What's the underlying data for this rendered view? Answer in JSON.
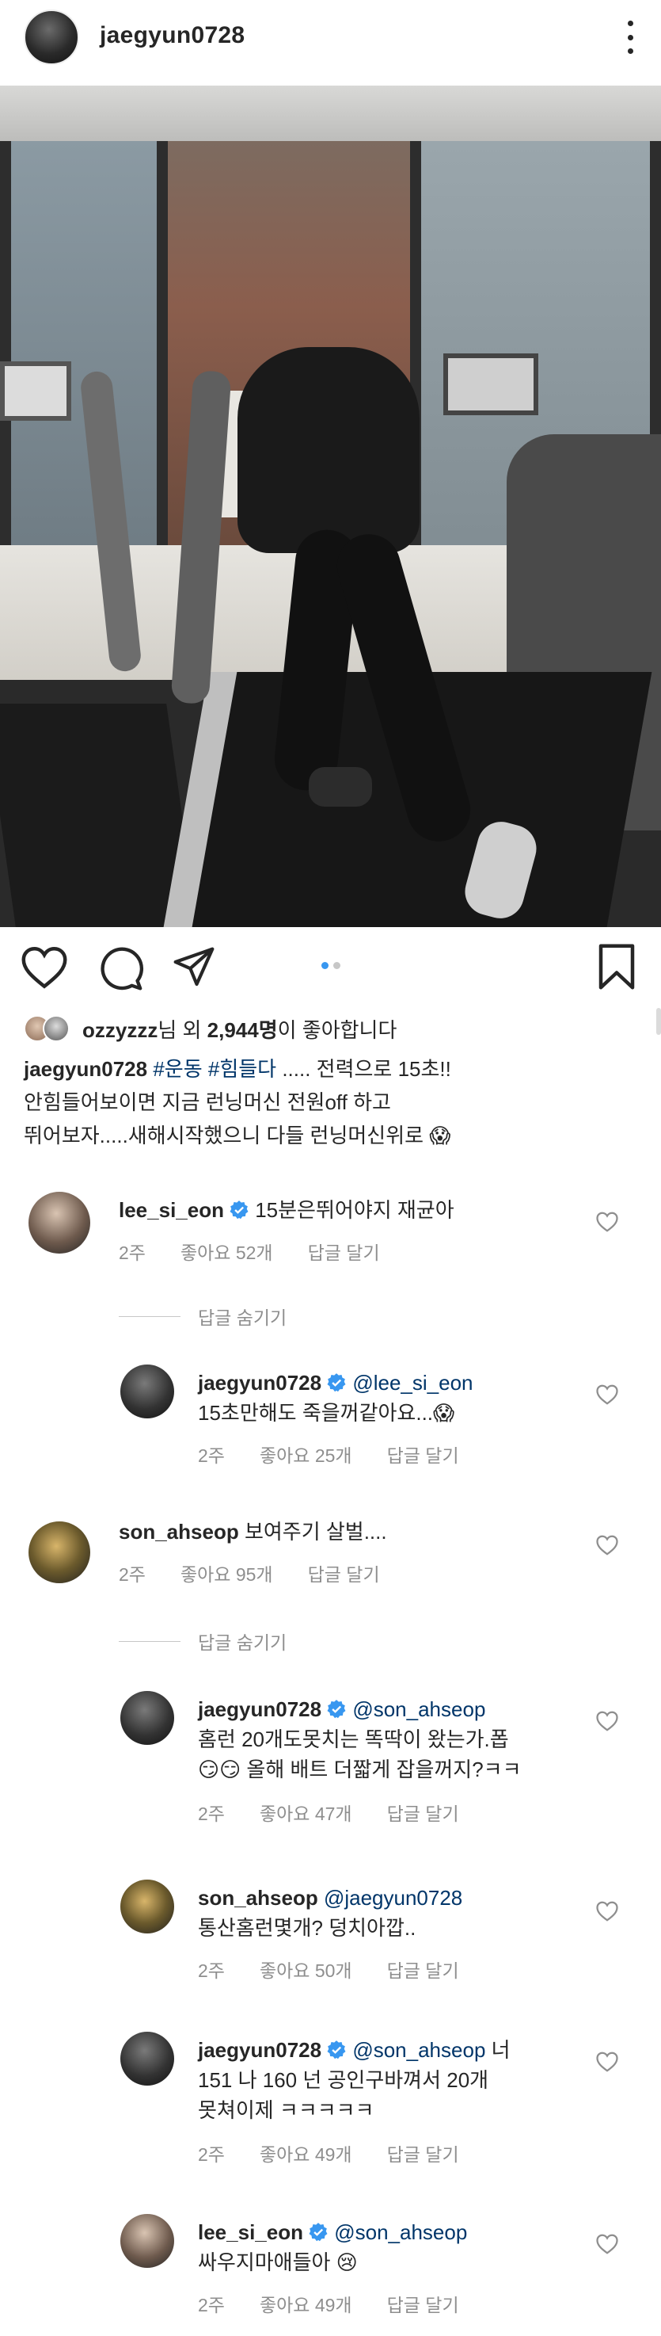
{
  "header": {
    "username": "jaegyun0728"
  },
  "post": {
    "likes": {
      "first_user": "ozzyzzz",
      "suffix_1": "님 외 ",
      "count": "2,944명",
      "suffix_2": "이 좋아합니다"
    },
    "caption": {
      "user": "jaegyun0728",
      "tags": [
        "#운동",
        "#힘들다"
      ],
      "line1_rest": " ..... 전력으로 15초!!",
      "line2": "안힘들어보이면 지금 런닝머신 전원off 하고",
      "line3": "뛰어보자.....새해시작했으니 다들 런닝머신위로 😱"
    }
  },
  "comments": [
    {
      "user": "lee_si_eon",
      "verified": true,
      "text": "15분은뛰어야지 재균아",
      "time": "2주",
      "likes": "좋아요 52개",
      "reply": "답글 달기"
    },
    {
      "user": "jaegyun0728",
      "verified": true,
      "mention": "@lee_si_eon",
      "text_line1": "",
      "text_line2": "15초만해도 죽을꺼같아요...😱",
      "time": "2주",
      "likes": "좋아요 25개",
      "reply": "답글 달기"
    },
    {
      "user": "son_ahseop",
      "verified": false,
      "text": "보여주기 살벌....",
      "time": "2주",
      "likes": "좋아요 95개",
      "reply": "답글 달기"
    },
    {
      "user": "jaegyun0728",
      "verified": true,
      "mention": "@son_ahseop",
      "text_line2": "홈런 20개도못치는 똑딱이 왔는가.폽",
      "text_line3": "😏😏 올해 배트 더짧게 잡을꺼지?ㅋㅋ",
      "time": "2주",
      "likes": "좋아요 47개",
      "reply": "답글 달기"
    },
    {
      "user": "son_ahseop",
      "verified": false,
      "mention": "@jaegyun0728",
      "text_line2": "통산홈런몇개? 덩치아깝..",
      "time": "2주",
      "likes": "좋아요 50개",
      "reply": "답글 달기"
    },
    {
      "user": "jaegyun0728",
      "verified": true,
      "mention": "@son_ahseop",
      "text_tail": " 너",
      "text_line2": "151 나 160 넌 공인구바껴서 20개",
      "text_line3": "못쳐이제 ㅋㅋㅋㅋㅋ",
      "time": "2주",
      "likes": "좋아요 49개",
      "reply": "답글 달기"
    },
    {
      "user": "lee_si_eon",
      "verified": true,
      "mention": "@son_ahseop",
      "text_line2": "싸우지마애들아 😢",
      "time": "2주",
      "likes": "좋아요 49개",
      "reply": "답글 달기"
    }
  ],
  "hide_replies_label": "답글 숨기기",
  "colors": {
    "text": "#262626",
    "meta": "#8e8e8e",
    "link": "#003569",
    "verified": "#3897f0",
    "dot_active": "#3897f0",
    "dot_inactive": "#c7c7c7"
  },
  "icons": [
    "more-icon",
    "heart-icon",
    "comment-icon",
    "share-icon",
    "bookmark-icon",
    "verified-icon"
  ]
}
